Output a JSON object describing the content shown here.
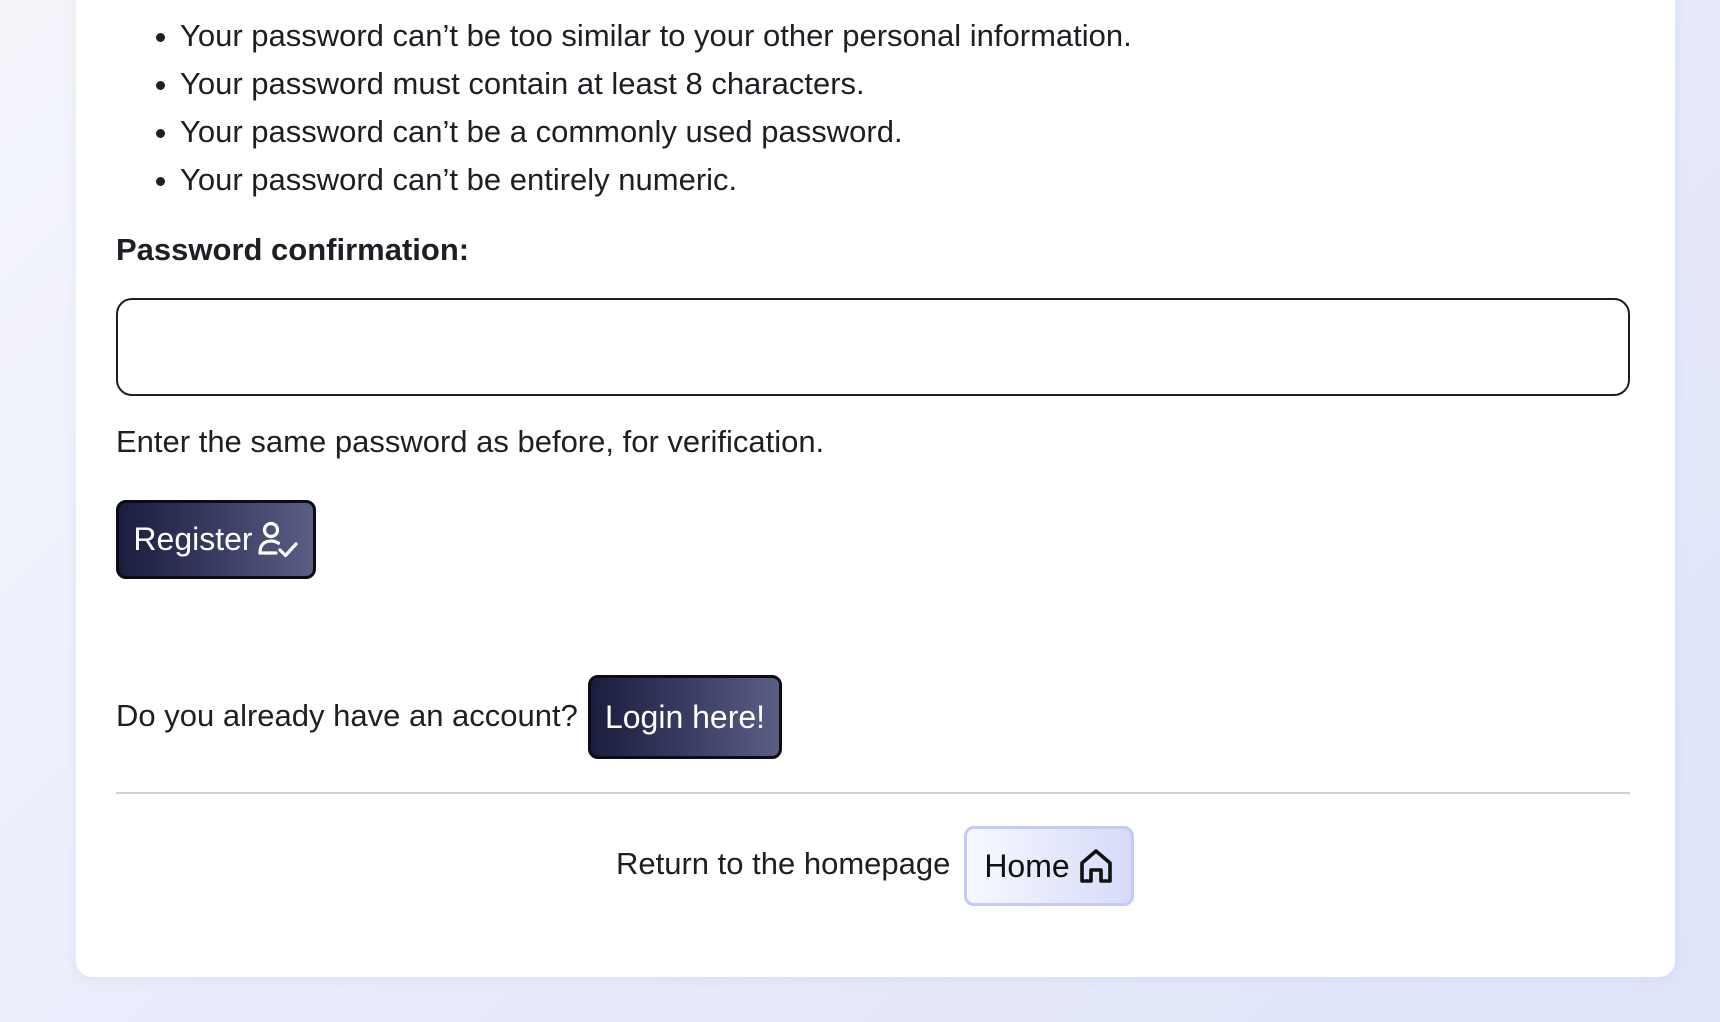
{
  "password_rules": [
    "Your password can’t be too similar to your other personal information.",
    "Your password must contain at least 8 characters.",
    "Your password can’t be a commonly used password.",
    "Your password can’t be entirely numeric."
  ],
  "password_confirmation": {
    "label": "Password confirmation:",
    "value": "",
    "help_text": "Enter the same password as before, for verification."
  },
  "register_button": {
    "label": "Register",
    "icon": "user-check-icon"
  },
  "login_prompt": {
    "text": "Do you already have an account?",
    "button_label": "Login here!"
  },
  "home_link": {
    "text": "Return to the homepage",
    "button_label": "Home",
    "icon": "home-icon"
  },
  "colors": {
    "background": "#e9ecfb",
    "card": "#ffffff",
    "text": "#1d1f24",
    "dark_button_start": "#1a1d3d",
    "dark_button_end": "#5a5d84",
    "home_button_border": "#c3cbf6"
  }
}
